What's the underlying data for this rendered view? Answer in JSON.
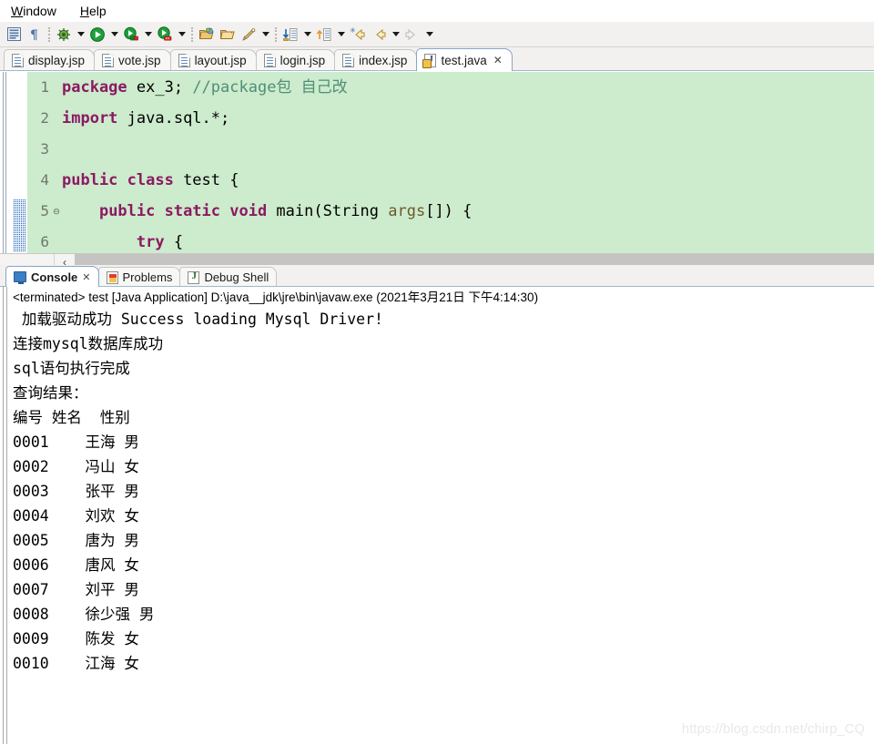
{
  "menubar": {
    "items": [
      {
        "name": "window",
        "pre": "",
        "mnemonic": "W",
        "post": "indow"
      },
      {
        "name": "help",
        "pre": "",
        "mnemonic": "H",
        "post": "elp"
      }
    ]
  },
  "toolbar": {
    "groups": [
      {
        "icons": [
          "outline-icon",
          "paragraph-mark-icon"
        ]
      },
      {
        "icons": [
          "debug-icon",
          "dropdown-arrow",
          "run-icon",
          "dropdown-arrow",
          "run-configurations-icon",
          "dropdown-arrow",
          "external-tools-icon",
          "dropdown-arrow"
        ]
      },
      {
        "icons": [
          "open-type-icon",
          "open-resource-icon",
          "search-icon",
          "dropdown-arrow"
        ]
      },
      {
        "icons": [
          "next-annotation-icon",
          "dropdown-arrow",
          "previous-annotation-icon",
          "dropdown-arrow",
          "last-edit-location-icon",
          "back-icon",
          "dropdown-arrow",
          "forward-icon",
          "dropdown-arrow"
        ]
      }
    ]
  },
  "editor": {
    "tabs": [
      {
        "label": "display.jsp",
        "icon": "jsp-file-icon",
        "active": false,
        "closable": false
      },
      {
        "label": "vote.jsp",
        "icon": "jsp-file-icon",
        "active": false,
        "closable": false
      },
      {
        "label": "layout.jsp",
        "icon": "jsp-file-icon",
        "active": false,
        "closable": false
      },
      {
        "label": "login.jsp",
        "icon": "jsp-file-icon",
        "active": false,
        "closable": false
      },
      {
        "label": "index.jsp",
        "icon": "jsp-file-icon",
        "active": false,
        "closable": false
      },
      {
        "label": "test.java",
        "icon": "java-file-warning-icon",
        "active": true,
        "closable": true,
        "close_glyph": "✕"
      }
    ],
    "background_color": "#cdebcd",
    "keyword_color": "#8b1a62",
    "comment_color": "#4f8f76",
    "lines": [
      {
        "number": "1",
        "fold": "",
        "tokens": [
          {
            "t": "package",
            "c": "kw"
          },
          {
            "t": " ex_3; ",
            "c": "pl"
          },
          {
            "t": "//package包 自己改",
            "c": "cm"
          }
        ]
      },
      {
        "number": "2",
        "fold": "",
        "tokens": [
          {
            "t": "import",
            "c": "kw"
          },
          {
            "t": " java.sql.*;",
            "c": "pl"
          }
        ]
      },
      {
        "number": "3",
        "fold": "",
        "tokens": []
      },
      {
        "number": "4",
        "fold": "",
        "tokens": [
          {
            "t": "public class",
            "c": "kw"
          },
          {
            "t": " test {",
            "c": "pl"
          }
        ]
      },
      {
        "number": "5",
        "fold": "⊖",
        "tokens": [
          {
            "t": "    ",
            "c": "pl"
          },
          {
            "t": "public static void",
            "c": "kw"
          },
          {
            "t": " main(String ",
            "c": "pl"
          },
          {
            "t": "args",
            "c": "var"
          },
          {
            "t": "[]) {",
            "c": "pl"
          }
        ]
      },
      {
        "number": "6",
        "fold": "",
        "tokens": [
          {
            "t": "        ",
            "c": "pl"
          },
          {
            "t": "try",
            "c": "kw"
          },
          {
            "t": " {",
            "c": "pl"
          }
        ]
      }
    ],
    "hscroll_left_glyph": "‹"
  },
  "console": {
    "tabs": [
      {
        "label": "Console",
        "icon": "console-icon",
        "active": true,
        "closable": true,
        "close_glyph": "✕"
      },
      {
        "label": "Problems",
        "icon": "problems-icon",
        "active": false,
        "closable": false
      },
      {
        "label": "Debug Shell",
        "icon": "debug-shell-icon",
        "active": false,
        "closable": false
      }
    ],
    "status_line": "<terminated> test [Java Application] D:\\java__jdk\\jre\\bin\\javaw.exe (2021年3月21日 下午4:14:30)",
    "output_lines": [
      " 加载驱动成功 Success loading Mysql Driver!",
      "连接mysql数据库成功",
      "sql语句执行完成",
      "查询结果：",
      "编号 姓名  性别",
      "0001    王海 男",
      "0002    冯山 女",
      "0003    张平 男",
      "0004    刘欢 女",
      "0005    唐为 男",
      "0006    唐风 女",
      "0007    刘平 男",
      "0008    徐少强 男",
      "0009    陈发 女",
      "0010    江海 女"
    ],
    "table": {
      "headers": [
        "编号",
        "姓名",
        "性别"
      ],
      "rows": [
        [
          "0001",
          "王海",
          "男"
        ],
        [
          "0002",
          "冯山",
          "女"
        ],
        [
          "0003",
          "张平",
          "男"
        ],
        [
          "0004",
          "刘欢",
          "女"
        ],
        [
          "0005",
          "唐为",
          "男"
        ],
        [
          "0006",
          "唐风",
          "女"
        ],
        [
          "0007",
          "刘平",
          "男"
        ],
        [
          "0008",
          "徐少强",
          "男"
        ],
        [
          "0009",
          "陈发",
          "女"
        ],
        [
          "0010",
          "江海",
          "女"
        ]
      ]
    }
  },
  "watermark": {
    "text": "https://blog.csdn.net/chirp_CQ"
  }
}
